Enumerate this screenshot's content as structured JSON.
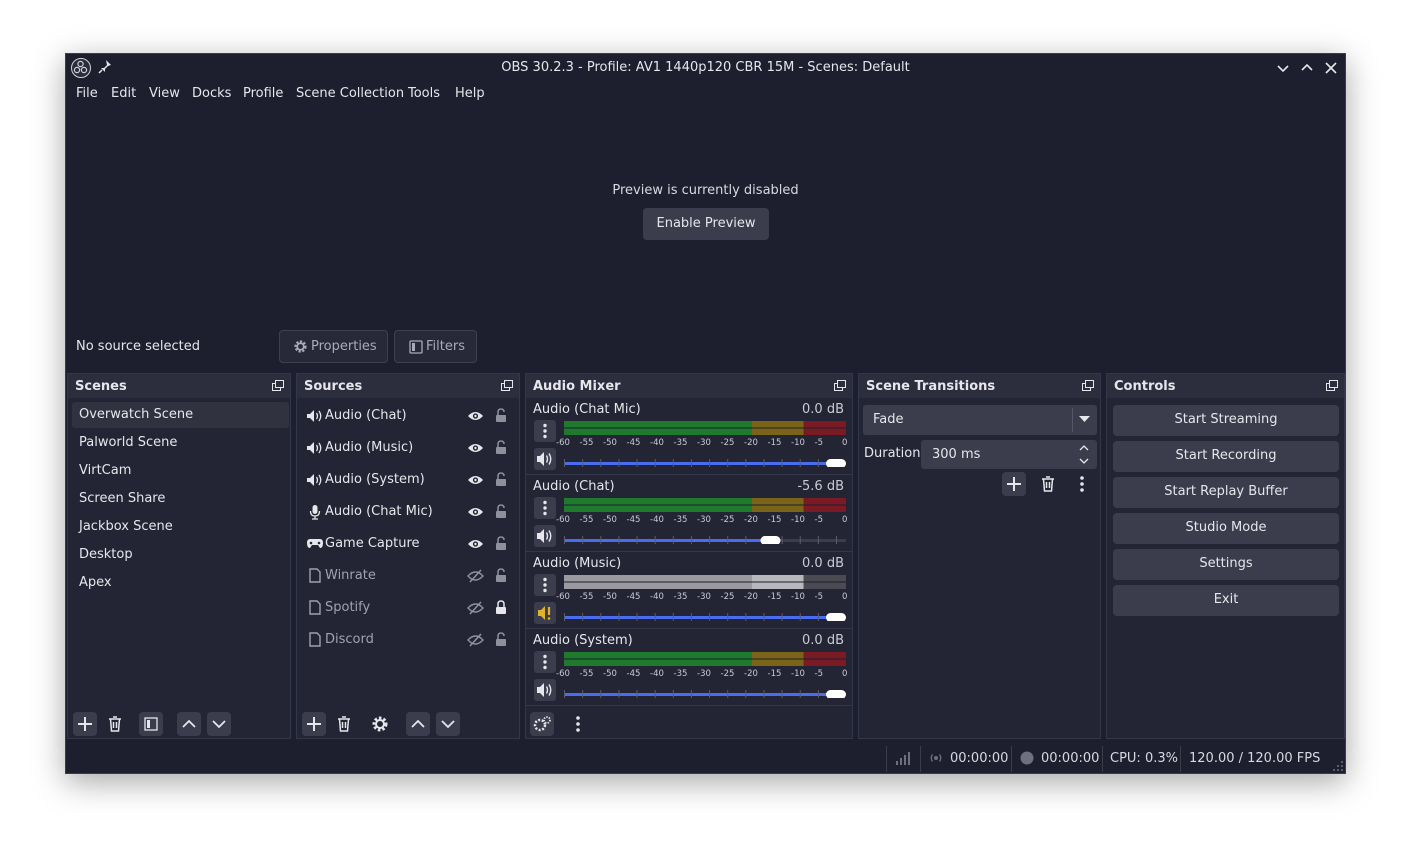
{
  "window": {
    "title": "OBS 30.2.3 - Profile: AV1 1440p120 CBR 15M - Scenes: Default"
  },
  "menu": [
    "File",
    "Edit",
    "View",
    "Docks",
    "Profile",
    "Scene Collection",
    "Tools",
    "Help"
  ],
  "preview": {
    "message": "Preview is currently disabled",
    "enable_label": "Enable Preview"
  },
  "context_bar": {
    "no_source": "No source selected",
    "properties_label": "Properties",
    "filters_label": "Filters"
  },
  "scenes": {
    "title": "Scenes",
    "items": [
      "Overwatch Scene",
      "Palworld Scene",
      "VirtCam",
      "Screen Share",
      "Jackbox Scene",
      "Desktop",
      "Apex"
    ],
    "selected": "Overwatch Scene"
  },
  "sources": {
    "title": "Sources",
    "items": [
      {
        "label": "Audio (Chat)",
        "icon": "speaker-icon",
        "visible": true,
        "locked": false
      },
      {
        "label": "Audio (Music)",
        "icon": "speaker-icon",
        "visible": true,
        "locked": false
      },
      {
        "label": "Audio (System)",
        "icon": "speaker-icon",
        "visible": true,
        "locked": false
      },
      {
        "label": "Audio (Chat Mic)",
        "icon": "microphone-icon",
        "visible": true,
        "locked": false
      },
      {
        "label": "Game Capture",
        "icon": "gamepad-icon",
        "visible": true,
        "locked": false
      },
      {
        "label": "Winrate",
        "icon": "file-icon",
        "visible": false,
        "locked": false
      },
      {
        "label": "Spotify",
        "icon": "file-icon",
        "visible": false,
        "locked": true
      },
      {
        "label": "Discord",
        "icon": "file-icon",
        "visible": false,
        "locked": false
      }
    ]
  },
  "mixer": {
    "title": "Audio Mixer",
    "ticks": [
      "-60",
      "-55",
      "-50",
      "-45",
      "-40",
      "-35",
      "-30",
      "-25",
      "-20",
      "-15",
      "-10",
      "-5",
      "0"
    ],
    "channels": [
      {
        "name": "Audio (Chat Mic)",
        "db": "0.0 dB",
        "fader": 1.0,
        "muted": false
      },
      {
        "name": "Audio (Chat)",
        "db": "-5.6 dB",
        "fader": 0.75,
        "muted": false
      },
      {
        "name": "Audio (Music)",
        "db": "0.0 dB",
        "fader": 1.0,
        "muted": true
      },
      {
        "name": "Audio (System)",
        "db": "0.0 dB",
        "fader": 1.0,
        "muted": false
      }
    ]
  },
  "transitions": {
    "title": "Scene Transitions",
    "selected": "Fade",
    "duration_label": "Duration",
    "duration_value": "300 ms"
  },
  "controls": {
    "title": "Controls",
    "buttons": [
      "Start Streaming",
      "Start Recording",
      "Start Replay Buffer",
      "Studio Mode",
      "Settings",
      "Exit"
    ]
  },
  "status": {
    "stream_time": "00:00:00",
    "record_time": "00:00:00",
    "cpu": "CPU: 0.3%",
    "fps": "120.00 / 120.00 FPS"
  },
  "colors": {
    "background": "#1d1f2e",
    "panel": "#232534",
    "button": "#3b3d4d",
    "meter_green": "#1f7a2e",
    "meter_yellow": "#7a6417",
    "meter_red": "#7a1a24",
    "fader_blue": "#4a6cf0"
  }
}
